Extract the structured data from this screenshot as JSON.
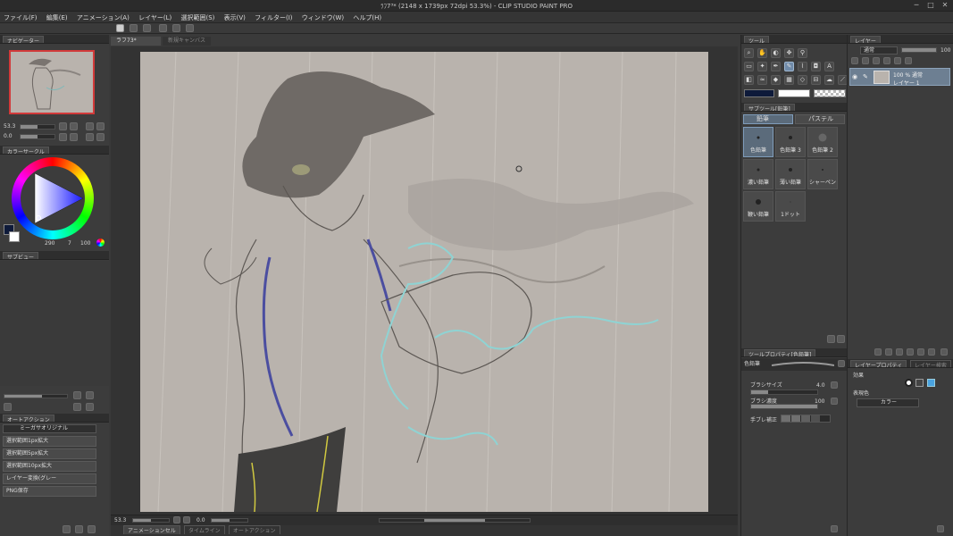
{
  "window": {
    "title": "ﾗﾌ7³* (2148 x 1739px 72dpi 53.3%) - CLIP STUDIO PAINT PRO",
    "minimize": "─",
    "maximize": "□",
    "close": "✕"
  },
  "menu": [
    "ファイル(F)",
    "編集(E)",
    "アニメーション(A)",
    "レイヤー(L)",
    "選択範囲(S)",
    "表示(V)",
    "フィルター(I)",
    "ウィンドウ(W)",
    "ヘルプ(H)"
  ],
  "document_tabs": [
    {
      "label": "ラフ73*"
    },
    {
      "label": "新規キャンバス1*"
    }
  ],
  "navigator": {
    "tab_label": "ナビゲーター",
    "zoom": "53.3",
    "rotation": "0.0"
  },
  "color_wheel": {
    "tab_label": "カラーサークル",
    "hsv": [
      "290",
      "7",
      "100"
    ]
  },
  "sub_view": {
    "tab_label": "サブビュー"
  },
  "auto_action": {
    "tab_label": "オートアクション",
    "set_name": "ミーガサオリジナル",
    "items": [
      "選択範囲1px拡大",
      "選択範囲5px拡大",
      "選択範囲10px拡大",
      "レイヤー変換(グレー",
      "PNG保存"
    ]
  },
  "status_bar": {
    "zoom": "53.3",
    "rotation": "0.0"
  },
  "bottom_tabs": [
    "アニメーションセル",
    "タイムライン",
    "オートアクション"
  ],
  "tool_panel": {
    "tab_label": "ツール"
  },
  "sub_tool": {
    "tab_label": "サブツール[鉛筆]",
    "groups": [
      "鉛筆",
      "パステル"
    ],
    "brushes": [
      "色鉛筆",
      "色鉛筆 3",
      "色鉛筆 2",
      "濃い鉛筆",
      "薄い鉛筆",
      "シャーペン",
      "鞭い鉛筆",
      "1ドット"
    ]
  },
  "tool_property": {
    "tab_label": "ツールプロパティ[色鉛筆]",
    "brush_name": "色鉛筆",
    "brush_size_label": "ブラシサイズ",
    "brush_size_value": "4.0",
    "brush_size_ratio": 0.25,
    "density_label": "ブラシ濃度",
    "density_value": "100",
    "density_ratio": 1.0,
    "stabilization_label": "手ブレ補正"
  },
  "layer_panel": {
    "tab_label": "レイヤー",
    "blend_mode": "通常",
    "opacity": "100",
    "layer_info": "100 % 通常",
    "layer_name": "レイヤー 1"
  },
  "layer_property": {
    "tab_label": "レイヤープロパティ",
    "tab2_label": "レイヤー検索",
    "effect_label": "効果",
    "expression_color_label": "表現色",
    "color_mode": "カラー"
  },
  "colors": {
    "accent": "#6f8aa8",
    "panel": "#3c3c3c",
    "canvas_paper": "#b9b3ad",
    "main_color": "#0e1a3a",
    "sub_color": "#ffffff"
  }
}
